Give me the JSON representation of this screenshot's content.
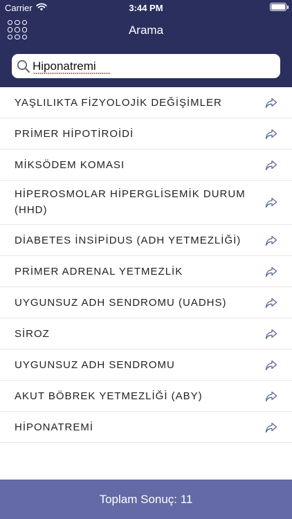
{
  "status_bar": {
    "carrier": "Carrier",
    "time": "3:44 PM"
  },
  "nav": {
    "title": "Arama",
    "menu_icon": "grid-menu-icon"
  },
  "search": {
    "value": "Hiponatremi",
    "icon": "search-icon"
  },
  "colors": {
    "header": "#2a2f5e",
    "footer": "#636aa6",
    "share_icon": "#5a6a95"
  },
  "results": [
    {
      "label": "YAŞLILIKTA FİZYOLOJİK DEĞİŞİMLER",
      "icon": "share-arrow-icon"
    },
    {
      "label": "PRİMER HİPOTİROİDİ",
      "icon": "share-arrow-icon"
    },
    {
      "label": "MİKSÖDEM KOMASI",
      "icon": "share-arrow-icon"
    },
    {
      "label": "HİPEROSMOLAR HİPERGLİSEMİK DURUM (HHD)",
      "icon": "share-arrow-icon"
    },
    {
      "label": "DİABETES İNSİPİDUS (ADH YETMEZLİĞİ)",
      "icon": "share-arrow-icon"
    },
    {
      "label": "PRİMER ADRENAL YETMEZLİK",
      "icon": "share-arrow-icon"
    },
    {
      "label": "UYGUNSUZ ADH SENDROMU (UADHS)",
      "icon": "share-arrow-icon"
    },
    {
      "label": "SİROZ",
      "icon": "share-arrow-icon"
    },
    {
      "label": "UYGUNSUZ ADH SENDROMU",
      "icon": "share-arrow-icon"
    },
    {
      "label": "AKUT BÖBREK YETMEZLİĞİ (ABY)",
      "icon": "share-arrow-icon"
    },
    {
      "label": "HİPONATREMİ",
      "icon": "share-arrow-icon"
    }
  ],
  "footer": {
    "total_label": "Toplam Sonuç: 11"
  }
}
